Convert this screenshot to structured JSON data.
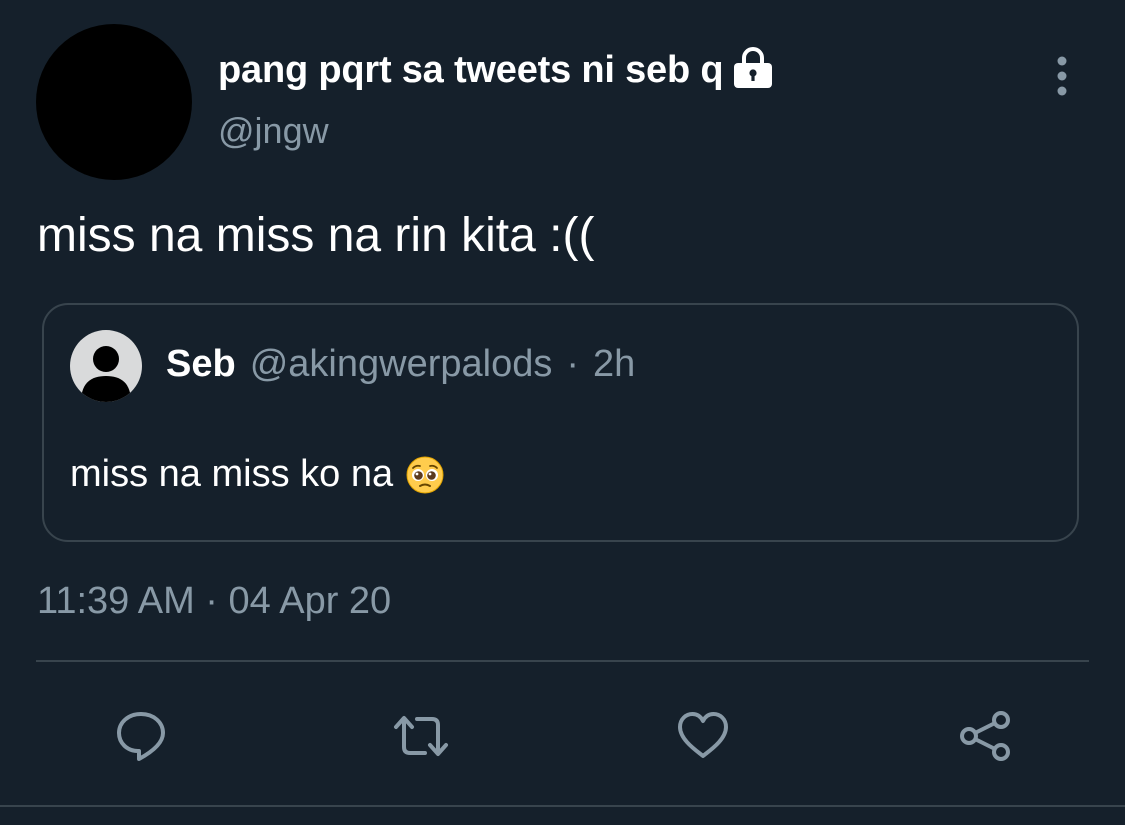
{
  "tweet": {
    "display_name": "pang pqrt sa tweets ni seb q",
    "handle": "@jngw",
    "text": "miss na miss na rin kita :((",
    "timestamp": "11:39 AM · 04 Apr 20"
  },
  "quoted": {
    "name": "Seb",
    "handle": "@akingwerpalods",
    "separator": "·",
    "time": "2h",
    "text": "miss na miss ko na"
  },
  "actions": {
    "reply_icon": "reply-icon",
    "retweet_icon": "retweet-icon",
    "like_icon": "heart-icon",
    "share_icon": "share-icon"
  },
  "colors": {
    "background": "#15202b",
    "primary_text": "#ffffff",
    "secondary_text": "#8899a6",
    "border": "#38444d"
  }
}
